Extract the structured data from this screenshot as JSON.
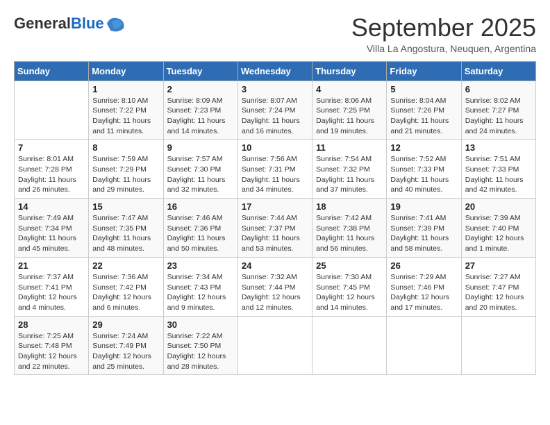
{
  "header": {
    "logo_general": "General",
    "logo_blue": "Blue",
    "month_title": "September 2025",
    "subtitle": "Villa La Angostura, Neuquen, Argentina"
  },
  "days_of_week": [
    "Sunday",
    "Monday",
    "Tuesday",
    "Wednesday",
    "Thursday",
    "Friday",
    "Saturday"
  ],
  "weeks": [
    [
      {
        "num": "",
        "info": ""
      },
      {
        "num": "1",
        "info": "Sunrise: 8:10 AM\nSunset: 7:22 PM\nDaylight: 11 hours\nand 11 minutes."
      },
      {
        "num": "2",
        "info": "Sunrise: 8:09 AM\nSunset: 7:23 PM\nDaylight: 11 hours\nand 14 minutes."
      },
      {
        "num": "3",
        "info": "Sunrise: 8:07 AM\nSunset: 7:24 PM\nDaylight: 11 hours\nand 16 minutes."
      },
      {
        "num": "4",
        "info": "Sunrise: 8:06 AM\nSunset: 7:25 PM\nDaylight: 11 hours\nand 19 minutes."
      },
      {
        "num": "5",
        "info": "Sunrise: 8:04 AM\nSunset: 7:26 PM\nDaylight: 11 hours\nand 21 minutes."
      },
      {
        "num": "6",
        "info": "Sunrise: 8:02 AM\nSunset: 7:27 PM\nDaylight: 11 hours\nand 24 minutes."
      }
    ],
    [
      {
        "num": "7",
        "info": "Sunrise: 8:01 AM\nSunset: 7:28 PM\nDaylight: 11 hours\nand 26 minutes."
      },
      {
        "num": "8",
        "info": "Sunrise: 7:59 AM\nSunset: 7:29 PM\nDaylight: 11 hours\nand 29 minutes."
      },
      {
        "num": "9",
        "info": "Sunrise: 7:57 AM\nSunset: 7:30 PM\nDaylight: 11 hours\nand 32 minutes."
      },
      {
        "num": "10",
        "info": "Sunrise: 7:56 AM\nSunset: 7:31 PM\nDaylight: 11 hours\nand 34 minutes."
      },
      {
        "num": "11",
        "info": "Sunrise: 7:54 AM\nSunset: 7:32 PM\nDaylight: 11 hours\nand 37 minutes."
      },
      {
        "num": "12",
        "info": "Sunrise: 7:52 AM\nSunset: 7:33 PM\nDaylight: 11 hours\nand 40 minutes."
      },
      {
        "num": "13",
        "info": "Sunrise: 7:51 AM\nSunset: 7:33 PM\nDaylight: 11 hours\nand 42 minutes."
      }
    ],
    [
      {
        "num": "14",
        "info": "Sunrise: 7:49 AM\nSunset: 7:34 PM\nDaylight: 11 hours\nand 45 minutes."
      },
      {
        "num": "15",
        "info": "Sunrise: 7:47 AM\nSunset: 7:35 PM\nDaylight: 11 hours\nand 48 minutes."
      },
      {
        "num": "16",
        "info": "Sunrise: 7:46 AM\nSunset: 7:36 PM\nDaylight: 11 hours\nand 50 minutes."
      },
      {
        "num": "17",
        "info": "Sunrise: 7:44 AM\nSunset: 7:37 PM\nDaylight: 11 hours\nand 53 minutes."
      },
      {
        "num": "18",
        "info": "Sunrise: 7:42 AM\nSunset: 7:38 PM\nDaylight: 11 hours\nand 56 minutes."
      },
      {
        "num": "19",
        "info": "Sunrise: 7:41 AM\nSunset: 7:39 PM\nDaylight: 11 hours\nand 58 minutes."
      },
      {
        "num": "20",
        "info": "Sunrise: 7:39 AM\nSunset: 7:40 PM\nDaylight: 12 hours\nand 1 minute."
      }
    ],
    [
      {
        "num": "21",
        "info": "Sunrise: 7:37 AM\nSunset: 7:41 PM\nDaylight: 12 hours\nand 4 minutes."
      },
      {
        "num": "22",
        "info": "Sunrise: 7:36 AM\nSunset: 7:42 PM\nDaylight: 12 hours\nand 6 minutes."
      },
      {
        "num": "23",
        "info": "Sunrise: 7:34 AM\nSunset: 7:43 PM\nDaylight: 12 hours\nand 9 minutes."
      },
      {
        "num": "24",
        "info": "Sunrise: 7:32 AM\nSunset: 7:44 PM\nDaylight: 12 hours\nand 12 minutes."
      },
      {
        "num": "25",
        "info": "Sunrise: 7:30 AM\nSunset: 7:45 PM\nDaylight: 12 hours\nand 14 minutes."
      },
      {
        "num": "26",
        "info": "Sunrise: 7:29 AM\nSunset: 7:46 PM\nDaylight: 12 hours\nand 17 minutes."
      },
      {
        "num": "27",
        "info": "Sunrise: 7:27 AM\nSunset: 7:47 PM\nDaylight: 12 hours\nand 20 minutes."
      }
    ],
    [
      {
        "num": "28",
        "info": "Sunrise: 7:25 AM\nSunset: 7:48 PM\nDaylight: 12 hours\nand 22 minutes."
      },
      {
        "num": "29",
        "info": "Sunrise: 7:24 AM\nSunset: 7:49 PM\nDaylight: 12 hours\nand 25 minutes."
      },
      {
        "num": "30",
        "info": "Sunrise: 7:22 AM\nSunset: 7:50 PM\nDaylight: 12 hours\nand 28 minutes."
      },
      {
        "num": "",
        "info": ""
      },
      {
        "num": "",
        "info": ""
      },
      {
        "num": "",
        "info": ""
      },
      {
        "num": "",
        "info": ""
      }
    ]
  ]
}
